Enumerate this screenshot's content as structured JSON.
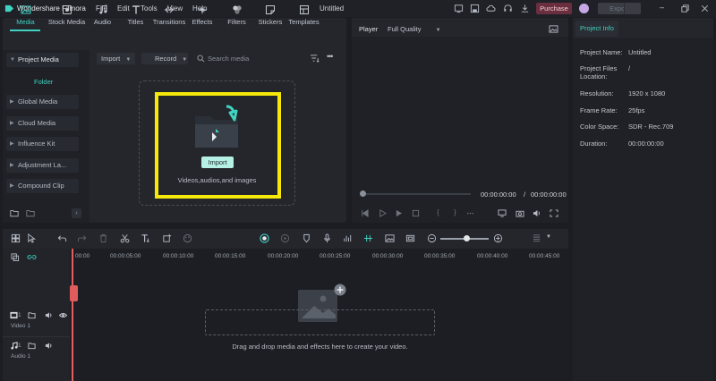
{
  "app": {
    "name": "Wondershare Filmora",
    "document_title": "Untitled",
    "menu": [
      "File",
      "Edit",
      "Tools",
      "View",
      "Help"
    ],
    "purchase_label": "Purchase",
    "export_label": "Export"
  },
  "media": {
    "tabs": [
      "Media",
      "Stock Media",
      "Audio",
      "Titles",
      "Transitions",
      "Effects",
      "Filters",
      "Stickers",
      "Templates"
    ],
    "active_tab": "Media",
    "nav": [
      "Project Media",
      "Global Media",
      "Cloud Media",
      "Influence Kit",
      "Adjustment La...",
      "Compound Clip"
    ],
    "nav_sub_folder": "Folder",
    "import_dropdown": "Import",
    "record_dropdown": "Record",
    "search_placeholder": "Search media",
    "import_button": "Import",
    "drop_caption": "Videos,audios,and images"
  },
  "player": {
    "label": "Player",
    "quality": "Full Quality",
    "current_time": "00:00:00:00",
    "separator": "/",
    "total_time": "00:00:00:00"
  },
  "project_info": {
    "tab": "Project Info",
    "name_label": "Project Name:",
    "name_value": "Untitled",
    "location_label_1": "Project Files",
    "location_label_2": "Location:",
    "location_value": "/",
    "resolution_label": "Resolution:",
    "resolution_value": "1920 x 1080",
    "framerate_label": "Frame Rate:",
    "framerate_value": "25fps",
    "colorspace_label": "Color Space:",
    "colorspace_value": "SDR - Rec.709",
    "duration_label": "Duration:",
    "duration_value": "00:00:00:00"
  },
  "timeline": {
    "ruler": [
      "00:00",
      "00:00:05:00",
      "00:00:10:00",
      "00:00:15:00",
      "00:00:20:00",
      "00:00:25:00",
      "00:00:30:00",
      "00:00:35:00",
      "00:00:40:00",
      "00:00:45:00"
    ],
    "video_track_num": "1",
    "video_track_name": "Video 1",
    "audio_track_num": "1",
    "audio_track_name": "Audio 1",
    "drop_caption": "Drag and drop media and effects here to create your video.",
    "zoom_level": 0.55
  },
  "colors": {
    "accent": "#3fd1c1",
    "highlight": "#f6e90a",
    "playhead": "#e35e5e"
  }
}
